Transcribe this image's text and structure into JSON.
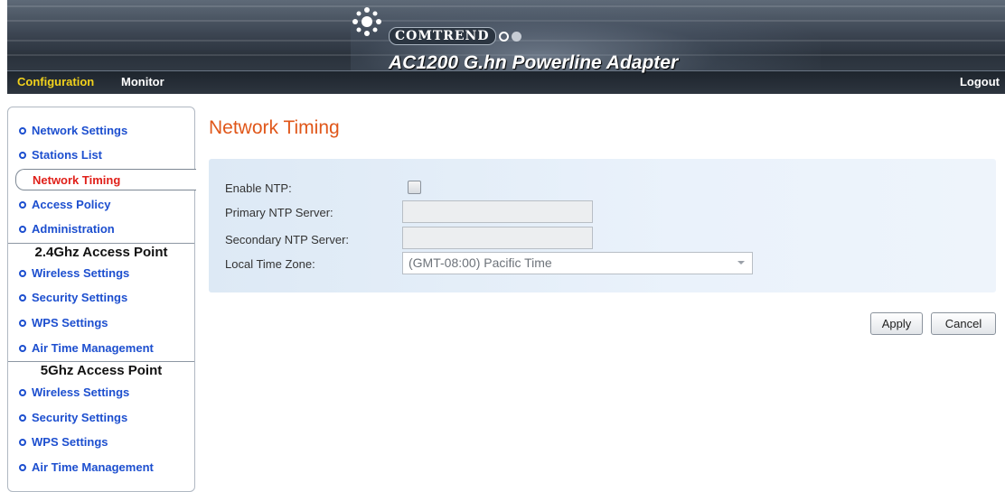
{
  "header": {
    "brand": "COMTREND",
    "product": "AC1200 G.hn Powerline Adapter",
    "tabs": [
      {
        "label": "Configuration",
        "active": true
      },
      {
        "label": "Monitor",
        "active": false
      }
    ],
    "logout": "Logout",
    "colors": {
      "active_tab": "#f2d21c",
      "tab": "#ffffff"
    }
  },
  "sidebar": {
    "items": [
      {
        "label": "Network Settings"
      },
      {
        "label": "Stations List"
      },
      {
        "label": "Network Timing",
        "active": true
      },
      {
        "label": "Access Policy"
      },
      {
        "label": "Administration"
      }
    ],
    "section_24": {
      "title": "2.4Ghz Access Point",
      "items": [
        {
          "label": "Wireless Settings"
        },
        {
          "label": "Security Settings"
        },
        {
          "label": "WPS Settings"
        },
        {
          "label": "Air Time Management"
        }
      ]
    },
    "section_5": {
      "title": "5Ghz Access Point",
      "items": [
        {
          "label": "Wireless Settings"
        },
        {
          "label": "Security Settings"
        },
        {
          "label": "WPS Settings"
        },
        {
          "label": "Air Time Management"
        }
      ]
    },
    "colors": {
      "link": "#1d4fcf",
      "active": "#e0201a"
    }
  },
  "main": {
    "title": "Network Timing",
    "form": {
      "enable_ntp_label": "Enable NTP:",
      "enable_ntp_checked": false,
      "primary_label": "Primary NTP Server:",
      "primary_value": "",
      "secondary_label": "Secondary NTP Server:",
      "secondary_value": "",
      "timezone_label": "Local Time Zone:",
      "timezone_value": "(GMT-08:00) Pacific Time"
    },
    "buttons": {
      "apply": "Apply",
      "cancel": "Cancel"
    },
    "colors": {
      "title": "#e0571a",
      "panel": "#e4eef9"
    }
  }
}
